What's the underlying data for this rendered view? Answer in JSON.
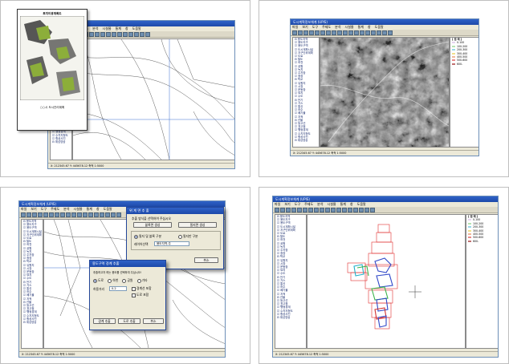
{
  "app": {
    "title": "도시계획정보체계 (UPIS)",
    "menus": [
      "파일",
      "보기",
      "도구",
      "주제도",
      "분석",
      "시설물",
      "통계",
      "창",
      "도움말"
    ],
    "tree_items": [
      "용도지역",
      "용도지구",
      "용도구역",
      "도시계획시설",
      "지구단위계획",
      "도로",
      "철도",
      "하천",
      "공원",
      "녹지",
      "주차장",
      "광장",
      "학교",
      "유원지",
      "시장",
      "운동장",
      "묘지",
      "수도",
      "전기",
      "가스",
      "통신",
      "하수",
      "폐기물",
      "지적",
      "건물",
      "등고선",
      "표고점",
      "행정경계",
      "수치지형도",
      "항공사진",
      "위성영상"
    ],
    "legend_title": "[ 범 례 ]",
    "legend_items": [
      {
        "label": "0-100",
        "color": "#e6d4f0"
      },
      {
        "label": "100-200",
        "color": "#b6e3b0"
      },
      {
        "label": "200-300",
        "color": "#98d8e8"
      },
      {
        "label": "300-400",
        "color": "#f2e08a"
      },
      {
        "label": "400-500",
        "color": "#f0b89a"
      },
      {
        "label": "500-600",
        "color": "#e88a8a"
      },
      {
        "label": "600-",
        "color": "#c07070"
      }
    ],
    "status": "X: 212345.67  Y: 445678.12  축척 1:5000"
  },
  "panel1": {
    "paper_title": "토지이용계획도",
    "paper_footer": "○○시 도시관리계획"
  },
  "dialog_top": {
    "title": "위 계 면 추 출",
    "buttons": [
      "블록면 생성",
      "필지면 생성",
      "취소"
    ],
    "group_label": "추출 방식을 선택하여 주십시오",
    "radio1": "필지 및 블록 구분",
    "radio2": "필지만 구분",
    "field_label": "레이어선택",
    "field_value": "용도지역-주"
  },
  "dialog_front": {
    "title": "용도구역 경계 추출",
    "prompt": "추출하고자 하는 용도를 선택하여 주십시오!",
    "radios": [
      "도로",
      "하천",
      "공원",
      "기타"
    ],
    "field_label": "허용거리",
    "field_value": "0.2",
    "checks": [
      "경계선 포함",
      "도로 포함"
    ],
    "buttons": [
      "경계 추출",
      "도로 추출",
      "취소"
    ]
  }
}
